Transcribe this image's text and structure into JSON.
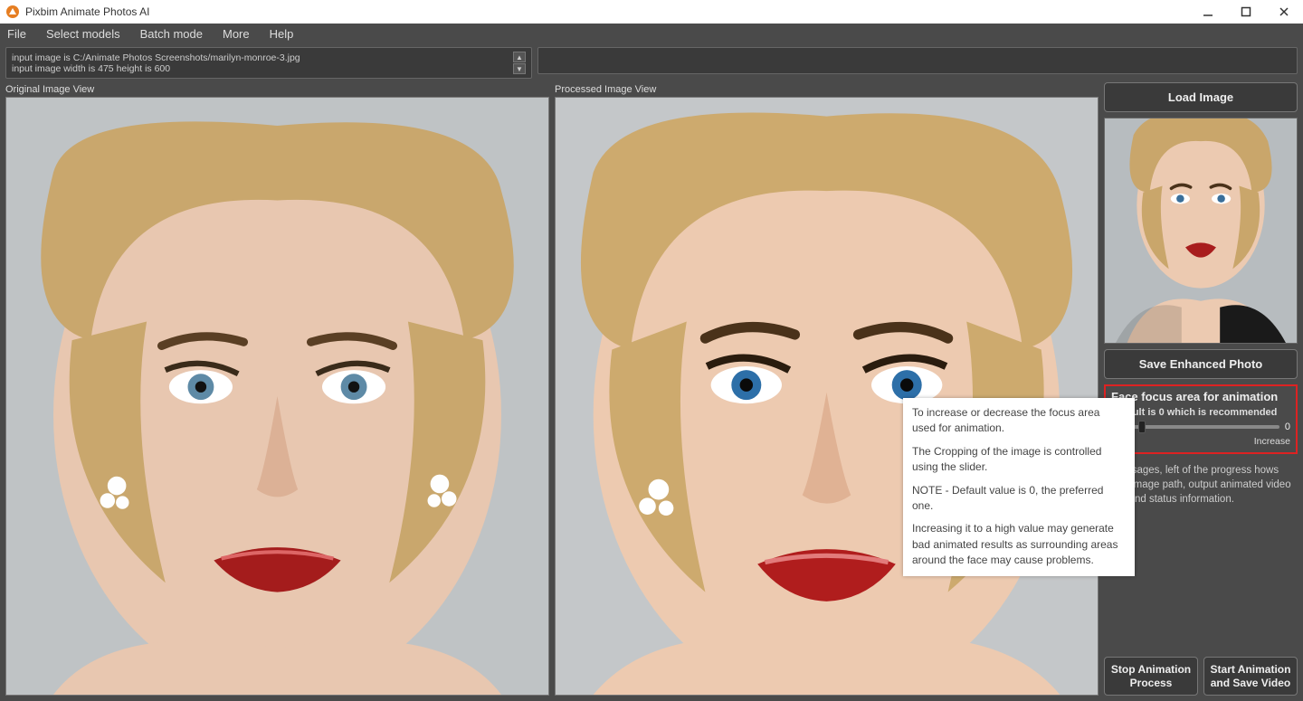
{
  "app": {
    "title": "Pixbim Animate Photos AI"
  },
  "menu": {
    "items": [
      "File",
      "Select models",
      "Batch mode",
      "More",
      "Help"
    ]
  },
  "info": {
    "line1": "input image is C:/Animate  Photos Screenshots/marilyn-monroe-3.jpg",
    "line2": "input image width is 475 height is 600"
  },
  "views": {
    "original_label": "Original Image View",
    "processed_label": "Processed Image View"
  },
  "sidebar": {
    "load_label": "Load Image",
    "save_label": "Save Enhanced Photo",
    "focus": {
      "title": "Face focus area for animation",
      "subtitle": "Default is 0 which is recommended",
      "value": "0",
      "right_label": "Increase"
    },
    "status_text": "r messages, left of the progress hows input image path, output animated video path and status information.",
    "stop_label": "Stop Animation\nProcess",
    "start_label": "Start Animation\nand Save Video"
  },
  "tooltip": {
    "p1": "To increase or decrease the focus area used for animation.",
    "p2": "The Cropping of the image is controlled using the slider.",
    "p3": "NOTE - Default value is 0, the preferred one.",
    "p4": "Increasing it to a high value may generate bad animated results as surrounding areas around the face may cause problems."
  }
}
